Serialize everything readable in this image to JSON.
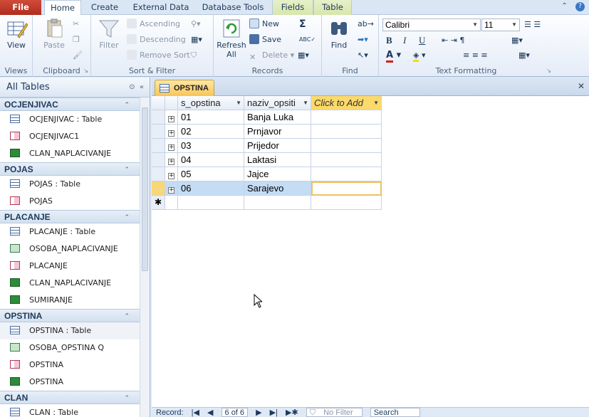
{
  "tabs": [
    "File",
    "Home",
    "Create",
    "External Data",
    "Database Tools",
    "Fields",
    "Table"
  ],
  "ribbon": {
    "views": {
      "view": "View",
      "label": "Views"
    },
    "clipboard": {
      "paste": "Paste",
      "label": "Clipboard"
    },
    "sortfilter": {
      "filter": "Filter",
      "ascending": "Ascending",
      "descending": "Descending",
      "remove_sort": "Remove Sort",
      "label": "Sort & Filter"
    },
    "records": {
      "refresh": "Refresh",
      "refresh2": "All",
      "new": "New",
      "save": "Save",
      "delete": "Delete",
      "totals": "Σ",
      "label": "Records"
    },
    "find": {
      "find": "Find",
      "label": "Find"
    },
    "text": {
      "font": "Calibri",
      "size": "11",
      "label": "Text Formatting"
    }
  },
  "nav": {
    "title": "All Tables",
    "groups": [
      {
        "name": "OCJENJIVAC",
        "items": [
          {
            "type": "table",
            "label": "OCJENJIVAC : Table"
          },
          {
            "type": "form",
            "label": "OCJENJIVAC1"
          },
          {
            "type": "report",
            "label": "CLAN_NAPLACIVANJE"
          }
        ]
      },
      {
        "name": "POJAS",
        "items": [
          {
            "type": "table",
            "label": "POJAS : Table"
          },
          {
            "type": "form",
            "label": "POJAS"
          }
        ]
      },
      {
        "name": "PLACANJE",
        "items": [
          {
            "type": "table",
            "label": "PLACANJE : Table"
          },
          {
            "type": "query",
            "label": "OSOBA_NAPLACIVANJE"
          },
          {
            "type": "form",
            "label": "PLACANJE"
          },
          {
            "type": "report",
            "label": "CLAN_NAPLACIVANJE"
          },
          {
            "type": "report",
            "label": "SUMIRANJE"
          }
        ]
      },
      {
        "name": "OPSTINA",
        "items": [
          {
            "type": "table",
            "label": "OPSTINA : Table",
            "selected": true
          },
          {
            "type": "query",
            "label": "OSOBA_OPSTINA Q"
          },
          {
            "type": "form",
            "label": "OPSTINA"
          },
          {
            "type": "report",
            "label": "OPSTINA"
          }
        ]
      },
      {
        "name": "CLAN",
        "items": [
          {
            "type": "table",
            "label": "CLAN : Table"
          }
        ]
      }
    ]
  },
  "document": {
    "tab_title": "OPSTINA",
    "columns": [
      "s_opstina",
      "naziv_opsiti",
      "Click to Add"
    ],
    "rows": [
      [
        "01",
        "Banja Luka"
      ],
      [
        "02",
        "Prnjavor"
      ],
      [
        "03",
        "Prijedor"
      ],
      [
        "04",
        "Laktasi"
      ],
      [
        "05",
        "Jajce"
      ],
      [
        "06",
        "Sarajevo"
      ]
    ],
    "current_row": 5,
    "new_row_marker": "✱"
  },
  "status": {
    "record_label": "Record:",
    "position": "6 of 6",
    "filter": "No Filter",
    "search": "Search"
  }
}
